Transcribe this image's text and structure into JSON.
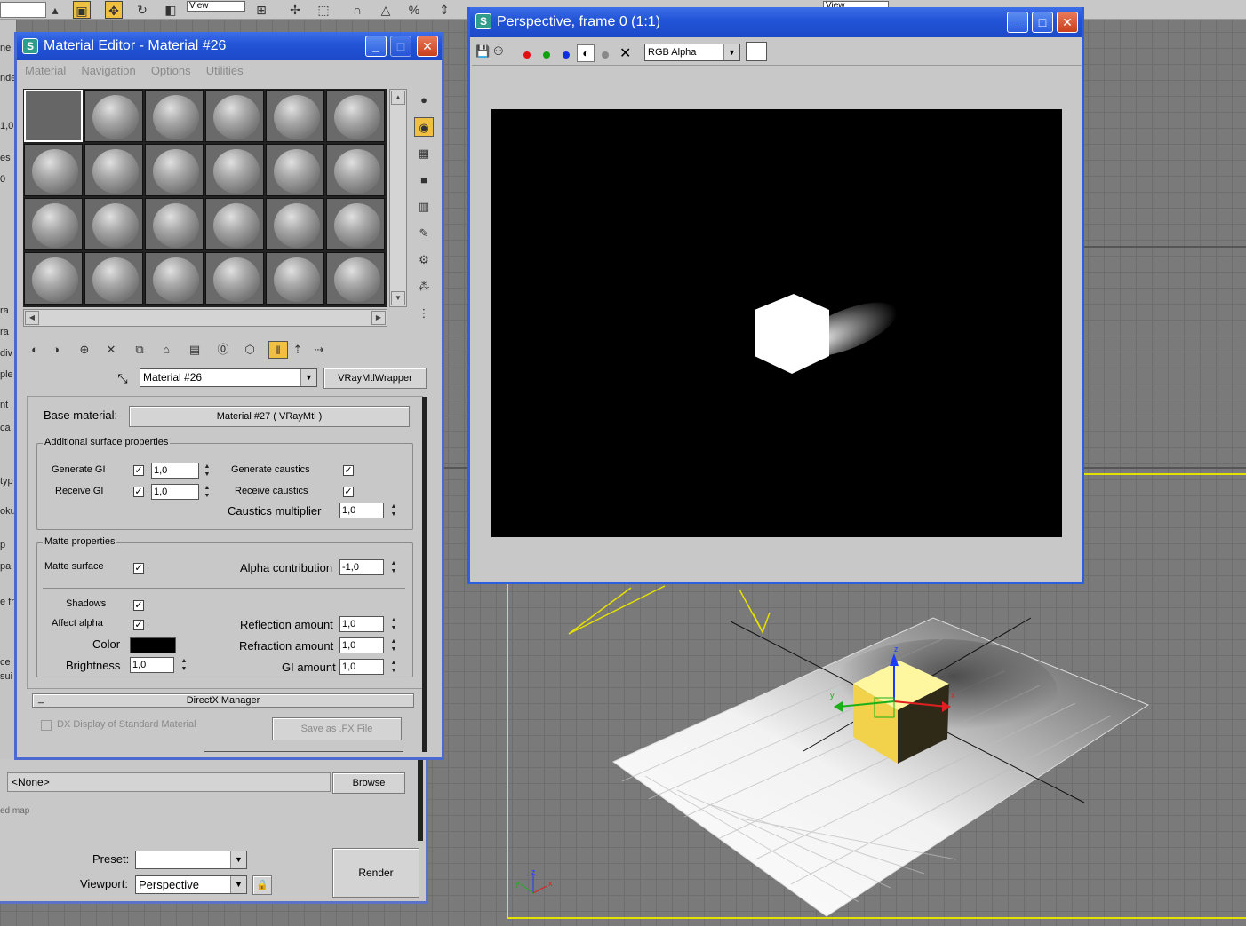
{
  "toolbar": {
    "view_combo_left": "View",
    "view_combo_right": "View"
  },
  "material_editor": {
    "title": "Material Editor - Material #26",
    "menu": [
      "Material",
      "Navigation",
      "Options",
      "Utilities"
    ],
    "material_name": "Material #26",
    "material_type": "VRayMtlWrapper",
    "base_material_label": "Base material:",
    "base_material_value": "Material #27  ( VRayMtl )",
    "additional": {
      "title": "Additional surface properties",
      "generate_gi": "Generate GI",
      "generate_gi_value": "1,0",
      "receive_gi": "Receive GI",
      "receive_gi_value": "1,0",
      "generate_caustics": "Generate caustics",
      "receive_caustics": "Receive caustics",
      "caustics_multiplier": "Caustics multiplier",
      "caustics_multiplier_value": "1,0"
    },
    "matte": {
      "title": "Matte properties",
      "matte_surface": "Matte surface",
      "alpha_contribution": "Alpha contribution",
      "alpha_contribution_value": "-1,0",
      "shadows": "Shadows",
      "affect_alpha": "Affect alpha",
      "color": "Color",
      "brightness": "Brightness",
      "brightness_value": "1,0",
      "reflection_amount": "Reflection amount",
      "reflection_amount_value": "1,0",
      "refraction_amount": "Refraction amount",
      "refraction_amount_value": "1,0",
      "gi_amount": "GI amount",
      "gi_amount_value": "1,0",
      "color_hex": "#000000"
    },
    "directx": {
      "title": "DirectX Manager",
      "collapse": "_",
      "dx_display": "DX Display of Standard Material",
      "save_fx": "Save as .FX File"
    }
  },
  "render_panel": {
    "none_value": "<None>",
    "browse": "Browse",
    "map_label": "ed map",
    "preset_label": "Preset:",
    "preset_value": "",
    "viewport_label": "Viewport:",
    "viewport_value": "Perspective",
    "render_button": "Render"
  },
  "left_strip": {
    "labels": [
      "ne",
      "nde",
      "1,0",
      "es",
      "0",
      "ra",
      "ra",
      "div",
      "ple",
      "nt",
      "ca",
      "typ",
      "oku",
      "p",
      "pa",
      "e fr",
      "ce",
      "sui"
    ]
  },
  "frame_window": {
    "title": "Perspective, frame 0 (1:1)",
    "channel": "RGB Alpha"
  },
  "scene": {
    "axis_x": "x",
    "axis_y": "y",
    "axis_z": "z",
    "gizmo_x": "x",
    "gizmo_y": "y",
    "gizmo_z": "z"
  }
}
